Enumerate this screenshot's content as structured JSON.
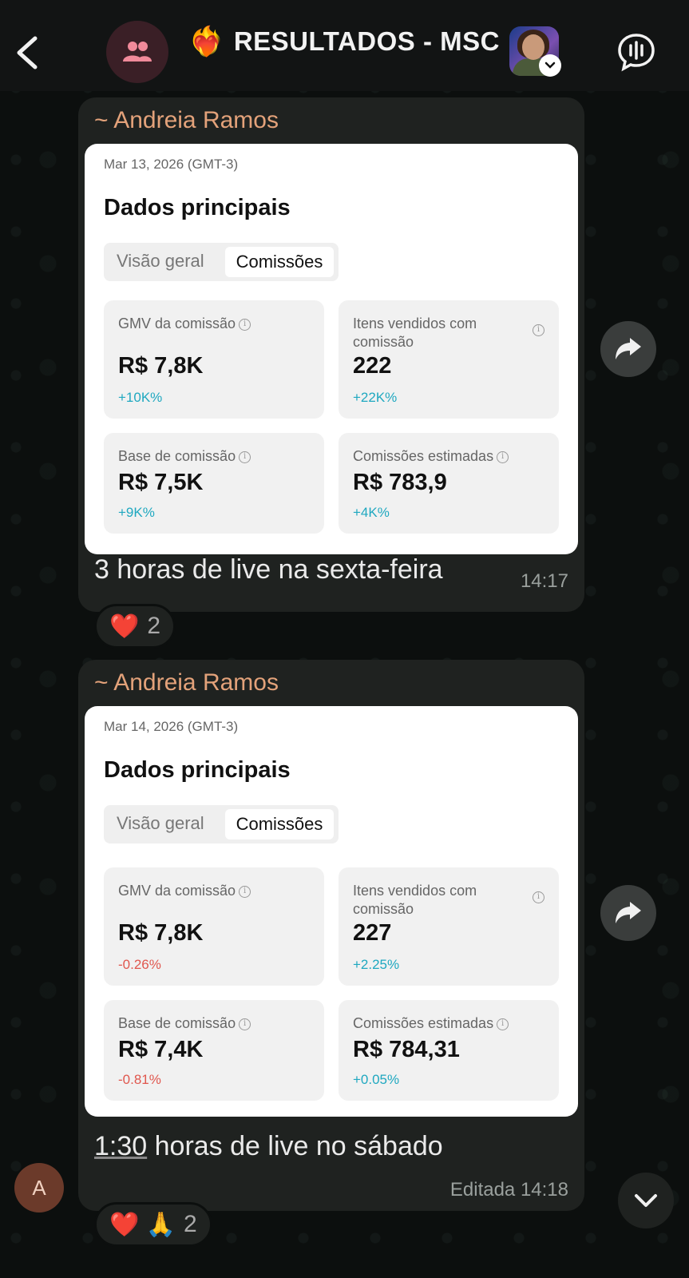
{
  "header": {
    "title_emoji": "❤️‍🔥",
    "title": "RESULTADOS - MSC"
  },
  "messages": [
    {
      "sender": "~ Andreia Ramos",
      "card": {
        "date": "Mar 13, 2026 (GMT-3)",
        "title": "Dados principais",
        "tab_overview": "Visão geral",
        "tab_commissions": "Comissões",
        "metrics": [
          {
            "label": "GMV da comissão",
            "value": "R$ 7,8K",
            "change": "+10K%",
            "direction": "up"
          },
          {
            "label": "Itens vendidos com comissão",
            "value": "222",
            "change": "+22K%",
            "direction": "up"
          },
          {
            "label": "Base de comissão",
            "value": "R$ 7,5K",
            "change": "+9K%",
            "direction": "up"
          },
          {
            "label": "Comissões estimadas",
            "value": "R$ 783,9",
            "change": "+4K%",
            "direction": "up"
          }
        ]
      },
      "caption": "3 horas de live na sexta-feira",
      "time": "14:17",
      "reactions": {
        "emojis": "❤️",
        "count": "2"
      }
    },
    {
      "sender": "~ Andreia Ramos",
      "card": {
        "date": "Mar 14, 2026 (GMT-3)",
        "title": "Dados principais",
        "tab_overview": "Visão geral",
        "tab_commissions": "Comissões",
        "metrics": [
          {
            "label": "GMV da comissão",
            "value": "R$ 7,8K",
            "change": "-0.26%",
            "direction": "down"
          },
          {
            "label": "Itens vendidos com comissão",
            "value": "227",
            "change": "+2.25%",
            "direction": "up"
          },
          {
            "label": "Base de comissão",
            "value": "R$ 7,4K",
            "change": "-0.81%",
            "direction": "down"
          },
          {
            "label": "Comissões estimadas",
            "value": "R$ 784,31",
            "change": "+0.05%",
            "direction": "up"
          }
        ]
      },
      "caption_link": "1:30",
      "caption_rest": " horas de live no sábado",
      "time": "Editada  14:18",
      "reactions": {
        "emojis": "❤️ 🙏",
        "count": "2"
      }
    }
  ],
  "sender_avatar_initial": "A",
  "colors": {
    "sender_name": "#e3a27a",
    "positive": "#1fa8c0",
    "negative": "#e0574e",
    "bubble": "#1f2220"
  }
}
